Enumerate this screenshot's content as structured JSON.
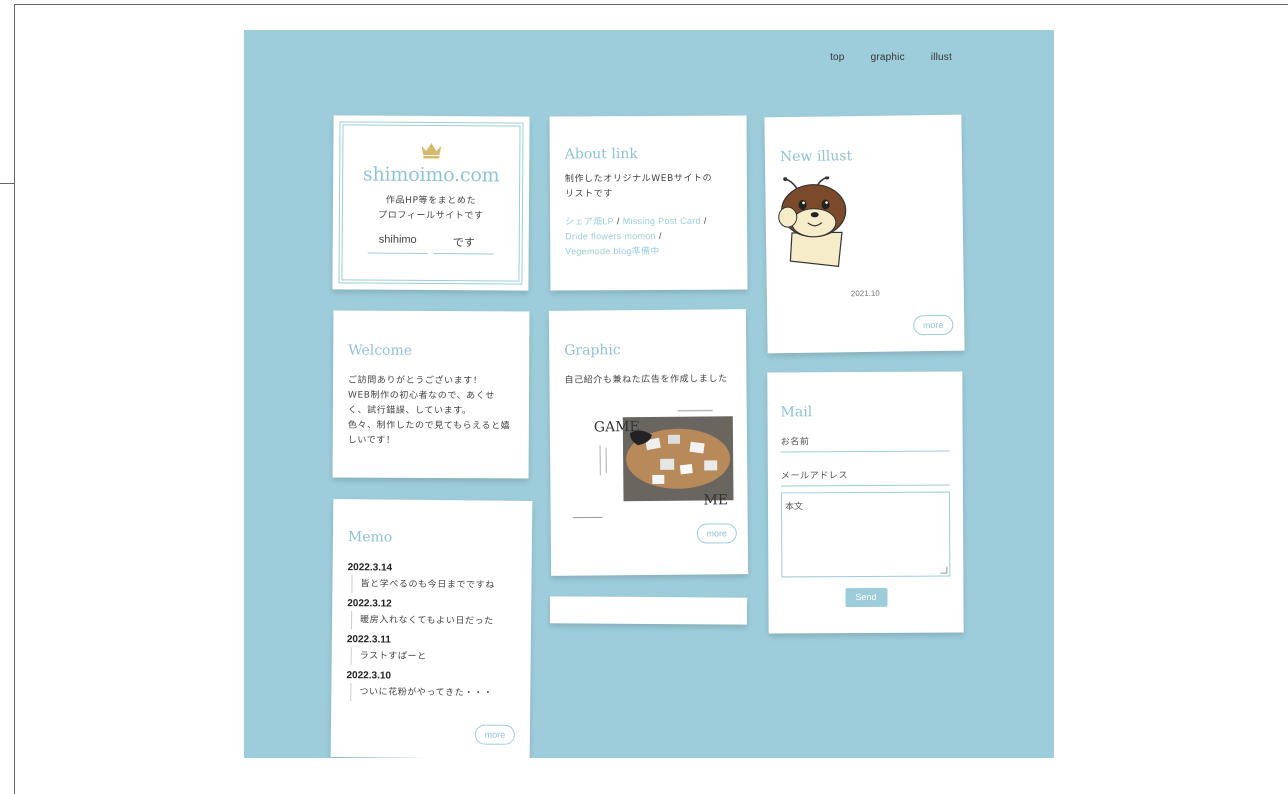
{
  "nav": {
    "items": [
      "top",
      "graphic",
      "illust"
    ]
  },
  "profile": {
    "site_title": "shimoimo.com",
    "desc_line1": "作品HP等をまとめた",
    "desc_line2": "プロフィールサイトです",
    "name1": "shihimo",
    "name2": "です"
  },
  "about": {
    "title": "About link",
    "desc_line1": "制作したオリジナルWEBサイトの",
    "desc_line2": "リストです",
    "links": [
      "シェア畑LP",
      "Missing Post Card",
      "Dride flowers momon",
      "Vegemode.blog準備中"
    ]
  },
  "new_illust": {
    "title": "New illust",
    "date": "2021.10",
    "more": "more"
  },
  "welcome": {
    "title": "Welcome",
    "lines": [
      "ご訪問ありがとうございます！",
      "WEB制作の初心者なので、あくせ",
      "く、試行錯誤、しています。",
      "色々、制作したので見てもらえると嬉",
      "しいです！"
    ]
  },
  "graphic": {
    "title": "Graphic",
    "desc": "自己紹介も兼ねた広告を作成しました",
    "poster_word1": "GAME",
    "poster_word2": "ME",
    "more": "more"
  },
  "memo": {
    "title": "Memo",
    "entries": [
      {
        "date": "2022.3.14",
        "text": "皆と学べるのも今日までですね"
      },
      {
        "date": "2022.3.12",
        "text": "暖房入れなくてもよい日だった"
      },
      {
        "date": "2022.3.11",
        "text": "ラストすぱーと"
      },
      {
        "date": "2022.3.10",
        "text": "ついに花粉がやってきた・・・"
      }
    ],
    "more": "more"
  },
  "mail": {
    "title": "Mail",
    "name_placeholder": "お名前",
    "email_placeholder": "メールアドレス",
    "body_placeholder": "本文",
    "send": "Send"
  },
  "colors": {
    "background": "#9dcddb",
    "accent": "#8fc3d6",
    "crown": "#d8b86a"
  }
}
